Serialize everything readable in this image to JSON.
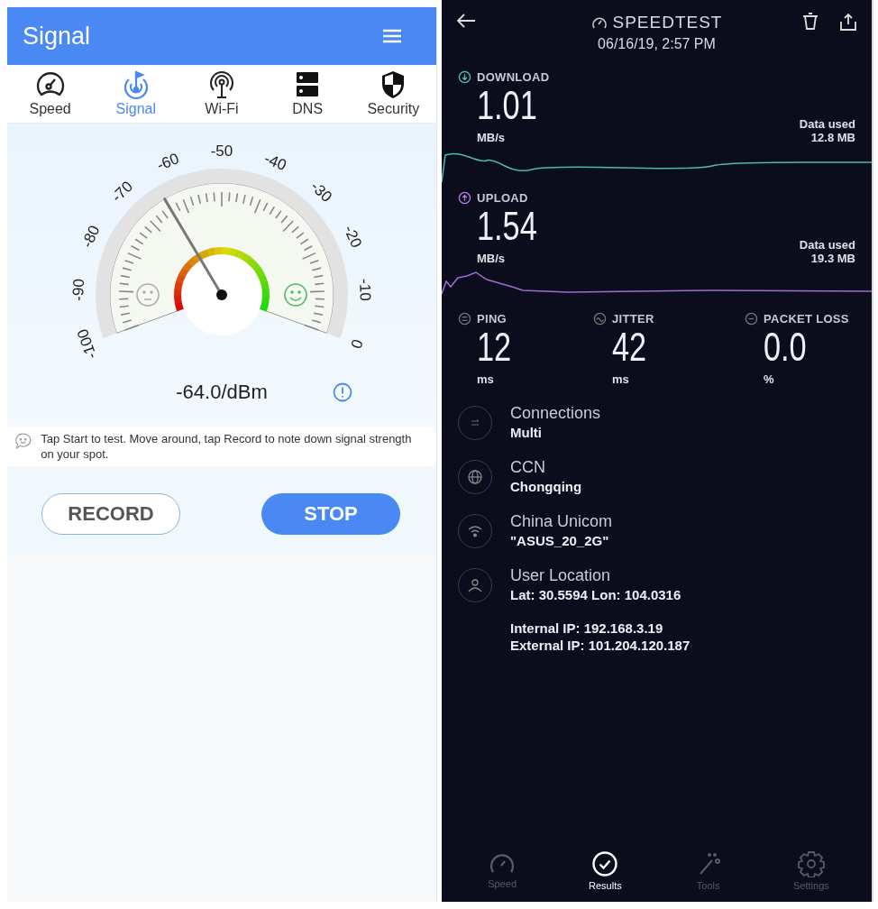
{
  "signal_app": {
    "title": "Signal",
    "tabs": [
      {
        "label": "Speed",
        "selected": false
      },
      {
        "label": "Signal",
        "selected": true
      },
      {
        "label": "Wi-Fi",
        "selected": false
      },
      {
        "label": "DNS",
        "selected": false
      },
      {
        "label": "Security",
        "selected": false
      }
    ],
    "gauge": {
      "scale_labels": [
        "-100",
        "-90",
        "-80",
        "-70",
        "-60",
        "-50",
        "-40",
        "-30",
        "-20",
        "-10",
        "0"
      ],
      "reading": "-64.0/dBm"
    },
    "hint": "Tap Start to test. Move around, tap Record to note down signal strength on your spot.",
    "buttons": [
      {
        "label": "RECORD",
        "kind": "outline"
      },
      {
        "label": "STOP",
        "kind": "filled"
      }
    ]
  },
  "speedtest": {
    "title": "SPEEDTEST",
    "timestamp": "06/16/19, 2:57 PM",
    "download": {
      "label": "DOWNLOAD",
      "value": "1.01",
      "unit": "MB/s",
      "data_used_label": "Data used",
      "data_used": "12.8 MB"
    },
    "upload": {
      "label": "UPLOAD",
      "value": "1.54",
      "unit": "MB/s",
      "data_used_label": "Data used",
      "data_used": "19.3 MB"
    },
    "metrics": [
      {
        "label": "PING",
        "value": "12",
        "unit": "ms"
      },
      {
        "label": "JITTER",
        "value": "42",
        "unit": "ms"
      },
      {
        "label": "PACKET LOSS",
        "value": "0.0",
        "unit": "%"
      }
    ],
    "details": [
      {
        "title": "Connections",
        "value": "Multi"
      },
      {
        "title": "CCN",
        "value": "Chongqing"
      },
      {
        "title": "China Unicom",
        "value": "\"ASUS_20_2G\""
      },
      {
        "title": "User Location",
        "value": "Lat: 30.5594 Lon: 104.0316",
        "extra": [
          "Internal IP: 192.168.3.19",
          "External IP: 101.204.120.187"
        ]
      }
    ],
    "nav": [
      {
        "label": "Speed",
        "selected": false
      },
      {
        "label": "Results",
        "selected": true
      },
      {
        "label": "Tools",
        "selected": false
      },
      {
        "label": "Settings",
        "selected": false
      }
    ]
  }
}
